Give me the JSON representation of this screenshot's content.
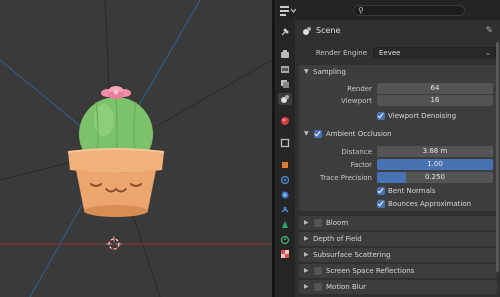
{
  "properties": {
    "context": {
      "scene_label": "Scene"
    },
    "render_engine": {
      "label": "Render Engine",
      "value": "Eevee"
    },
    "sampling": {
      "title": "Sampling",
      "render_label": "Render",
      "render_value": "64",
      "viewport_label": "Viewport",
      "viewport_value": "16",
      "viewport_denoising_label": "Viewport Denoising",
      "viewport_denoising_checked": true
    },
    "ambient_occlusion": {
      "title": "Ambient Occlusion",
      "enabled": true,
      "distance_label": "Distance",
      "distance_value": "3.68 m",
      "factor_label": "Factor",
      "factor_value": "1.00",
      "factor_fill": 1.0,
      "trace_precision_label": "Trace Precision",
      "trace_precision_value": "0.250",
      "trace_precision_fill": 0.25,
      "bent_normals_label": "Bent Normals",
      "bent_normals_checked": true,
      "bounces_label": "Bounces Approximation",
      "bounces_checked": true
    },
    "collapsed_panels": [
      {
        "title": "Bloom",
        "has_checkbox": true,
        "checked": false
      },
      {
        "title": "Depth of Field",
        "has_checkbox": false
      },
      {
        "title": "Subsurface Scattering",
        "has_checkbox": false
      },
      {
        "title": "Screen Space Reflections",
        "has_checkbox": true,
        "checked": false
      },
      {
        "title": "Motion Blur",
        "has_checkbox": true,
        "checked": false
      }
    ]
  },
  "colors": {
    "accent_blue": "#4772b3",
    "panel_bg": "#3d3d3d",
    "editor_bg": "#303030",
    "viewport_bg": "#3a3a3a",
    "pot": "#f0b27a",
    "cactus": "#7cc26a",
    "flower": "#ee8fa7"
  },
  "icons": {
    "tabs": [
      "tool-icon",
      "render-icon",
      "output-icon",
      "view-layer-icon",
      "scene-icon",
      "world-icon",
      "object-icon",
      "modifier-icon",
      "particles-icon",
      "physics-icon",
      "constraints-icon",
      "data-icon",
      "material-icon",
      "texture-icon"
    ]
  }
}
